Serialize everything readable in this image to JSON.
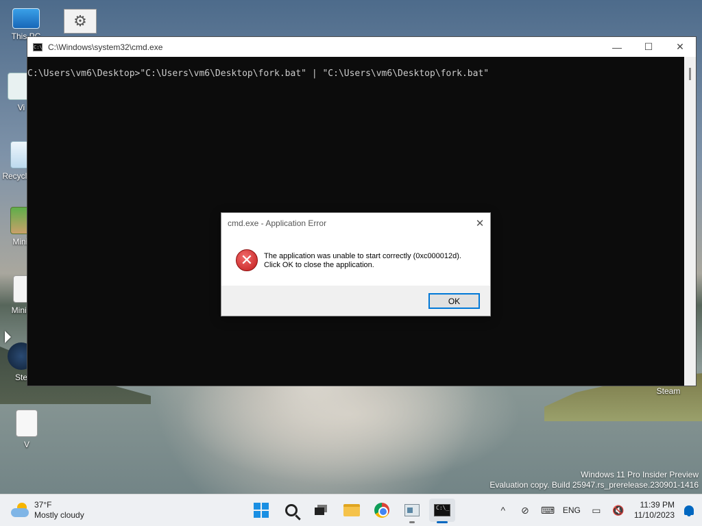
{
  "desktop": {
    "icons": [
      {
        "label": "This PC",
        "icon": "monitor-icon"
      },
      {
        "label": "Vi",
        "icon": "application-icon"
      },
      {
        "label": "Recycle Bin",
        "icon": "recycle-bin-icon"
      },
      {
        "label": "Mini V",
        "icon": "game-shortcut-icon"
      },
      {
        "label": "MiniPa",
        "icon": "document-icon"
      },
      {
        "label": "Ste",
        "icon": "steam-icon"
      },
      {
        "label": "V",
        "icon": "text-file-icon"
      }
    ],
    "steam_label": "Steam"
  },
  "cmd_window": {
    "title": "C:\\Windows\\system32\\cmd.exe",
    "line1": "C:\\Users\\vm6\\Desktop>\"C:\\Users\\vm6\\Desktop\\fork.bat\" | \"C:\\Users\\vm6\\Desktop\\fork.bat\"",
    "controls": {
      "minimize": "—",
      "maximize": "☐",
      "close": "✕"
    }
  },
  "dialog": {
    "title": "cmd.exe - Application Error",
    "message_line1": "The application was unable to start correctly (0xc000012d).",
    "message_line2": "Click OK to close the application.",
    "ok_label": "OK",
    "close_glyph": "✕",
    "icon": "error-icon",
    "error_glyph": "✕"
  },
  "watermark": {
    "line1": "Windows 11 Pro Insider Preview",
    "line2": "Evaluation copy. Build 25947.rs_prerelease.230901-1416"
  },
  "taskbar": {
    "weather": {
      "temp": "37°F",
      "condition": "Mostly cloudy"
    },
    "apps": [
      "start",
      "search",
      "task-view",
      "file-explorer",
      "chrome",
      "app",
      "terminal"
    ],
    "tray": {
      "chevron": "^",
      "language": "ENG",
      "time": "11:39 PM",
      "date": "11/10/2023"
    }
  },
  "colors": {
    "accent": "#0067c0",
    "error_red": "#c01b1b",
    "cmd_bg": "#0c0c0c",
    "cmd_text": "#cccccc"
  }
}
